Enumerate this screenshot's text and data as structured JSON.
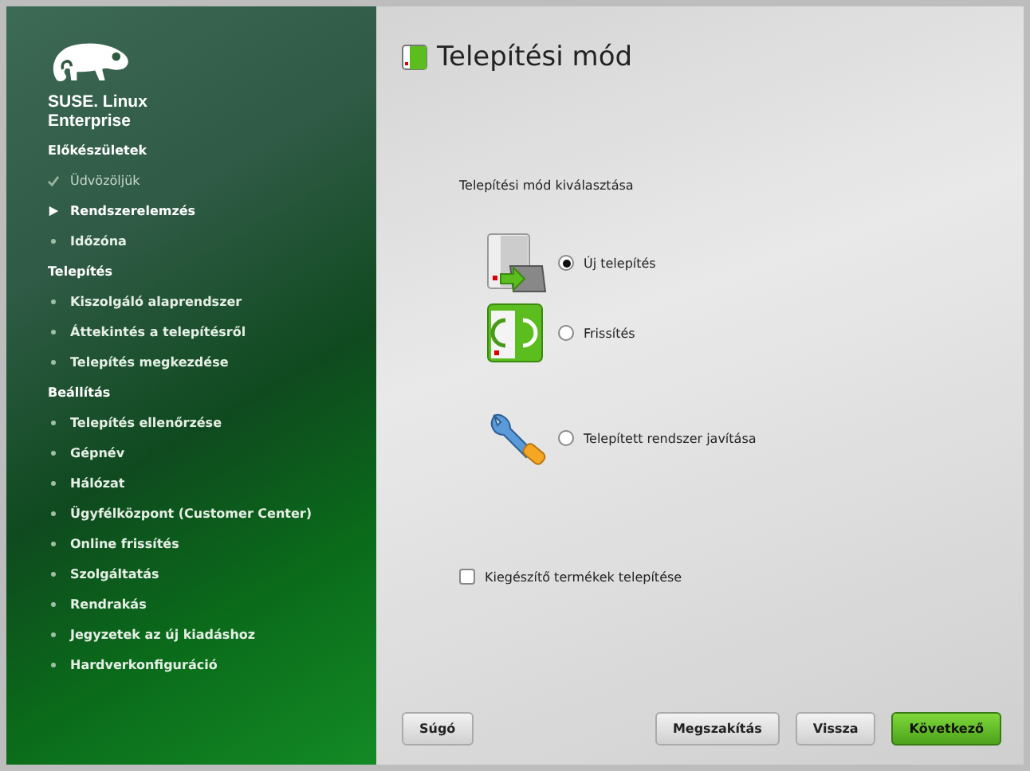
{
  "brand": {
    "line_1": "SUSE. Linux",
    "line_2": "Enterprise"
  },
  "sidebar": {
    "sections": [
      {
        "title": "Előkészületek",
        "steps": [
          {
            "label": "Üdvözöljük",
            "done": true,
            "current": false
          },
          {
            "label": "Rendszerelemzés",
            "done": false,
            "current": true
          },
          {
            "label": "Időzóna",
            "done": false,
            "current": false
          }
        ]
      },
      {
        "title": "Telepítés",
        "steps": [
          {
            "label": "Kiszolgáló alaprendszer",
            "done": false,
            "current": false
          },
          {
            "label": "Áttekintés a telepítésről",
            "done": false,
            "current": false
          },
          {
            "label": "Telepítés megkezdése",
            "done": false,
            "current": false
          }
        ]
      },
      {
        "title": "Beállítás",
        "steps": [
          {
            "label": "Telepítés ellenőrzése",
            "done": false,
            "current": false
          },
          {
            "label": "Gépnév",
            "done": false,
            "current": false
          },
          {
            "label": "Hálózat",
            "done": false,
            "current": false
          },
          {
            "label": "Ügyfélközpont (Customer Center)",
            "done": false,
            "current": false
          },
          {
            "label": "Online frissítés",
            "done": false,
            "current": false
          },
          {
            "label": "Szolgáltatás",
            "done": false,
            "current": false
          },
          {
            "label": "Rendrakás",
            "done": false,
            "current": false
          },
          {
            "label": "Jegyzetek az új kiadáshoz",
            "done": false,
            "current": false
          },
          {
            "label": "Hardverkonfiguráció",
            "done": false,
            "current": false
          }
        ]
      }
    ]
  },
  "page": {
    "title": "Telepítési mód",
    "group_label": "Telepítési mód kiválasztása",
    "options": [
      {
        "kind": "install",
        "label": "Új telepítés",
        "selected": true
      },
      {
        "kind": "update",
        "label": "Frissítés",
        "selected": false
      },
      {
        "kind": "repair",
        "label": "Telepített rendszer javítása",
        "selected": false
      }
    ],
    "addon": {
      "label": "Kiegészítő termékek telepítése",
      "checked": false
    }
  },
  "buttons": [
    {
      "label": "Súgó",
      "kind": "help"
    },
    {
      "label": "Megszakítás",
      "kind": "normal"
    },
    {
      "label": "Vissza",
      "kind": "normal"
    },
    {
      "label": "Következő",
      "kind": "primary"
    }
  ]
}
